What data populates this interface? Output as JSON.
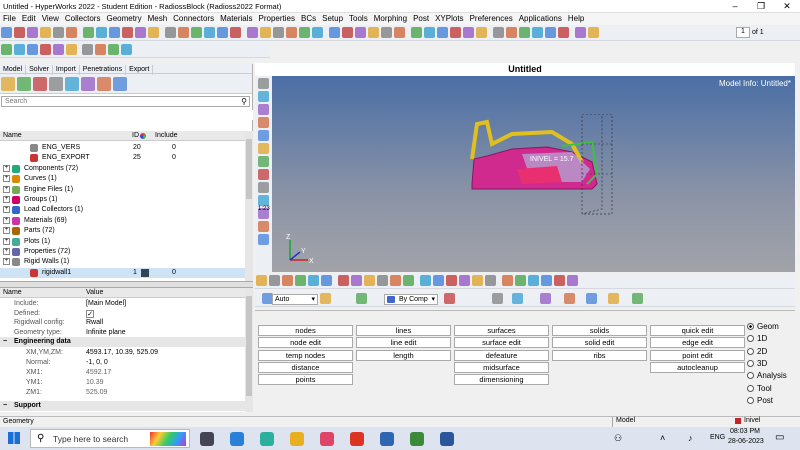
{
  "window": {
    "title": "Untitled - HyperWorks 2022 - Student Edition - RadiossBlock (Radioss2022 Format)",
    "minimize": "–",
    "maximize": "❐",
    "close": "✕"
  },
  "menu": [
    "File",
    "Edit",
    "View",
    "Collectors",
    "Geometry",
    "Mesh",
    "Connectors",
    "Materials",
    "Properties",
    "BCs",
    "Setup",
    "Tools",
    "Morphing",
    "Post",
    "XYPlots",
    "Preferences",
    "Applications",
    "Help"
  ],
  "toolbar": {
    "page_value": "1",
    "page_of": "of 1"
  },
  "left_tabs": [
    "Model",
    "Solver",
    "Import",
    "Penetrations",
    "Export"
  ],
  "search": {
    "placeholder": "Search"
  },
  "tree_headers": {
    "name": "Name",
    "id": "ID",
    "include": "Include"
  },
  "tree": [
    {
      "label": "ENG_VERS",
      "id": "20",
      "inc": "0",
      "indent": 2
    },
    {
      "label": "ENG_EXPORT",
      "id": "25",
      "inc": "0",
      "indent": 2
    },
    {
      "label": "Components (72)",
      "id": "",
      "inc": "",
      "indent": 0
    },
    {
      "label": "Curves (1)",
      "id": "",
      "inc": "",
      "indent": 0
    },
    {
      "label": "Engine Files (1)",
      "id": "",
      "inc": "",
      "indent": 0
    },
    {
      "label": "Groups (1)",
      "id": "",
      "inc": "",
      "indent": 0
    },
    {
      "label": "Load Collectors (1)",
      "id": "",
      "inc": "",
      "indent": 0
    },
    {
      "label": "Materials (69)",
      "id": "",
      "inc": "",
      "indent": 0
    },
    {
      "label": "Parts (72)",
      "id": "",
      "inc": "",
      "indent": 0
    },
    {
      "label": "Plots (1)",
      "id": "",
      "inc": "",
      "indent": 0
    },
    {
      "label": "Properties (72)",
      "id": "",
      "inc": "",
      "indent": 0
    },
    {
      "label": "Rigid Walls (1)",
      "id": "",
      "inc": "",
      "indent": 0
    },
    {
      "label": "rigidwall1",
      "id": "1",
      "inc": "0",
      "indent": 2
    }
  ],
  "props_headers": {
    "name": "Name",
    "value": "Value"
  },
  "props": [
    {
      "k": "Include:",
      "v": "[Main Model]"
    },
    {
      "k": "Defined:",
      "v": "✓"
    },
    {
      "k": "Rigidwall config:",
      "v": "Rwall"
    },
    {
      "k": "Geometry type:",
      "v": "Infinite plane"
    }
  ],
  "eng_section": "Engineering data",
  "eng_props": [
    {
      "k": "XM,YM,ZM:",
      "v": "4593.17, 10.39, 525.09"
    },
    {
      "k": "Normal:",
      "v": "-1, 0, 0"
    },
    {
      "k": "XM1:",
      "v": "4592.17"
    },
    {
      "k": "YM1:",
      "v": "10.39"
    },
    {
      "k": "ZM1:",
      "v": "525.09"
    }
  ],
  "support_section": "Support",
  "viewport": {
    "title": "Untitled",
    "model_info": "Model Info: Untitled*",
    "invel_label": "INIVEL = 15.7",
    "scale": "1:23",
    "axis_x": "X",
    "axis_y": "Y",
    "axis_z": "Z"
  },
  "view_bar": {
    "auto": "Auto",
    "by_comp": "By Comp"
  },
  "panels": {
    "col1": [
      "nodes",
      "node edit",
      "temp nodes",
      "distance",
      "points"
    ],
    "col2": [
      "lines",
      "line edit",
      "length"
    ],
    "col3": [
      "surfaces",
      "surface edit",
      "defeature",
      "midsurface",
      "dimensioning"
    ],
    "col4": [
      "solids",
      "solid edit",
      "ribs"
    ],
    "col5": [
      "quick edit",
      "edge edit",
      "point edit",
      "autocleanup"
    ]
  },
  "radios": [
    {
      "label": "Geom",
      "on": true
    },
    {
      "label": "1D",
      "on": false
    },
    {
      "label": "2D",
      "on": false
    },
    {
      "label": "3D",
      "on": false
    },
    {
      "label": "Analysis",
      "on": false
    },
    {
      "label": "Tool",
      "on": false
    },
    {
      "label": "Post",
      "on": false
    }
  ],
  "status": {
    "left": "Geometry",
    "model": "Model",
    "inivel": "Inivel"
  },
  "taskbar": {
    "search": "Type here to search",
    "lang": "ENG",
    "time": "08:03 PM",
    "date": "28-06-2023"
  }
}
